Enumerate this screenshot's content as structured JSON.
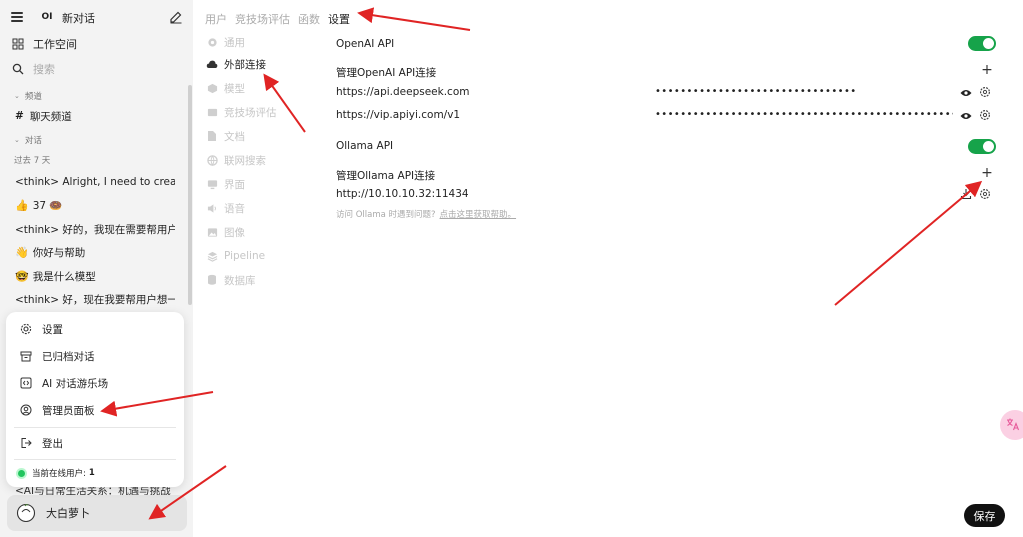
{
  "sidebar": {
    "new_chat": "新对话",
    "logo": "OI",
    "workspace": "工作空间",
    "search_placeholder": "搜索",
    "channels_section": "频道",
    "channel_name": "聊天频道",
    "chats_section": "对话",
    "time_group": "过去 7 天",
    "conversations": [
      {
        "emoji": "",
        "title": "<think> Alright, I need to create a"
      },
      {
        "emoji": "👍",
        "title": "37 🍩"
      },
      {
        "emoji": "",
        "title": "<think> 好的，我现在需要帮用户生"
      },
      {
        "emoji": "👋",
        "title": "你好与帮助"
      },
      {
        "emoji": "🤓",
        "title": "我是什么模型"
      },
      {
        "emoji": "",
        "title": "<think> 好，现在我要帮用户想一个"
      }
    ],
    "behind_conversation": "<AI与日常生活关系：机遇与挑战",
    "user_name": "大白萝卜"
  },
  "user_menu": {
    "items": [
      "设置",
      "已归档对话",
      "AI 对话游乐场",
      "管理员面板"
    ],
    "logout": "登出",
    "online_label": "当前在线用户:",
    "online_count": "1"
  },
  "main": {
    "tabs": [
      "用户",
      "竞技场评估",
      "函数",
      "设置"
    ],
    "active_tab": 3,
    "nav": [
      {
        "label": "通用",
        "icon": "gear-icon"
      },
      {
        "label": "外部连接",
        "icon": "cloud-icon"
      },
      {
        "label": "模型",
        "icon": "cube-icon"
      },
      {
        "label": "竞技场评估",
        "icon": "scale-icon"
      },
      {
        "label": "文档",
        "icon": "document-icon"
      },
      {
        "label": "联网搜索",
        "icon": "globe-icon"
      },
      {
        "label": "界面",
        "icon": "monitor-icon"
      },
      {
        "label": "语音",
        "icon": "speaker-icon"
      },
      {
        "label": "图像",
        "icon": "image-icon"
      },
      {
        "label": "Pipeline",
        "icon": "layers-icon"
      },
      {
        "label": "数据库",
        "icon": "database-icon"
      }
    ],
    "active_nav": 1
  },
  "settings": {
    "openai_title": "OpenAI API",
    "openai_enabled": true,
    "openai_manage": "管理OpenAI API连接",
    "openai_connections": [
      {
        "url": "https://api.deepseek.com",
        "key_mask": "••••••••••••••••••••••••••••••••"
      },
      {
        "url": "https://vip.apiyi.com/v1",
        "key_mask": "••••••••••••••••••••••••••••••••••••••••••••••••"
      }
    ],
    "ollama_title": "Ollama API",
    "ollama_enabled": true,
    "ollama_manage": "管理Ollama API连接",
    "ollama_url": "http://10.10.10.32:11434",
    "ollama_help": "访问 Ollama 时遇到问题?",
    "ollama_help_link": "点击这里获取帮助。",
    "save_label": "保存"
  },
  "colors": {
    "toggle_on": "#16a34a",
    "annotation_arrow": "#e02424",
    "online_dot": "#22c55e"
  }
}
